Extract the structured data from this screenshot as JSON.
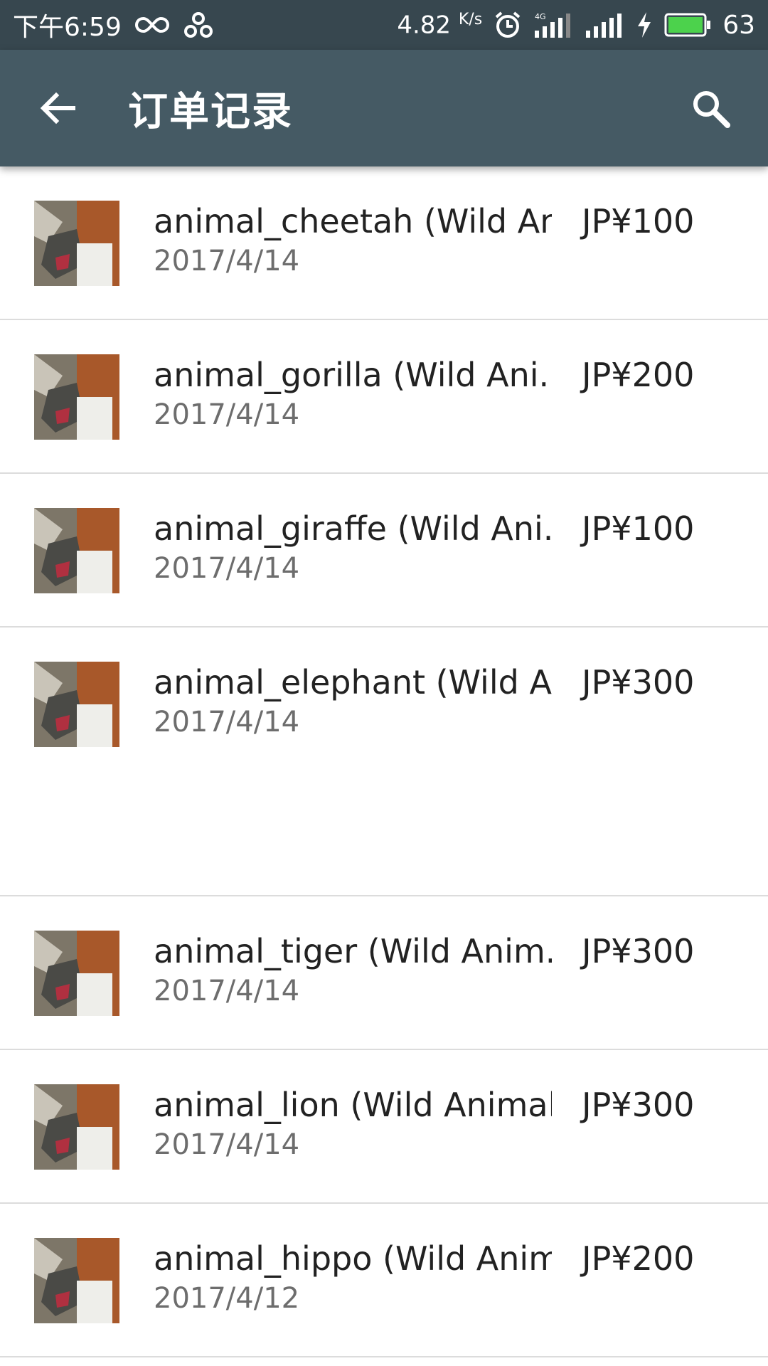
{
  "status_bar": {
    "time": "下午6:59",
    "speed": "4.82",
    "speed_unit": "K/s",
    "network": "4G",
    "battery": "63"
  },
  "app_bar": {
    "title": "订单记录",
    "back_icon": "arrow-left-icon",
    "search_icon": "search-icon"
  },
  "orders": [
    {
      "name": "animal_cheetah (Wild An..",
      "date": "2017/4/14",
      "price": "JP¥100"
    },
    {
      "name": "animal_gorilla (Wild Ani..",
      "date": "2017/4/14",
      "price": "JP¥200"
    },
    {
      "name": "animal_giraffe (Wild Ani..",
      "date": "2017/4/14",
      "price": "JP¥100"
    },
    {
      "name": "animal_elephant (Wild A..",
      "date": "2017/4/14",
      "price": "JP¥300"
    },
    {
      "name": "animal_tiger (Wild Anim..",
      "date": "2017/4/14",
      "price": "JP¥300"
    },
    {
      "name": "animal_lion (Wild Animal..",
      "date": "2017/4/14",
      "price": "JP¥300"
    },
    {
      "name": "animal_hippo (Wild Anim..",
      "date": "2017/4/12",
      "price": "JP¥200"
    }
  ],
  "colors": {
    "status_bar": "#37474f",
    "app_bar": "#455a64",
    "battery_fill": "#4cd24c"
  }
}
